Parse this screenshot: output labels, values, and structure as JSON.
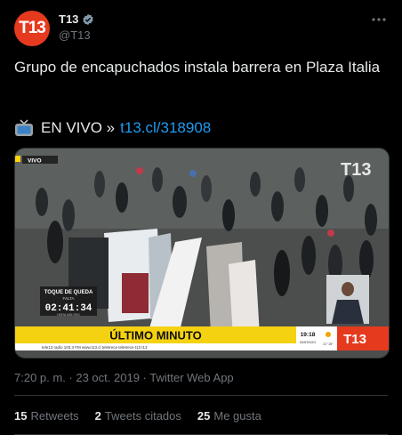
{
  "tweet": {
    "author": {
      "display_name": "T13",
      "handle": "@T13",
      "avatar_logo": "T13"
    },
    "text": "Grupo de encapuchados instala barrera en Plaza Italia",
    "live_label": "EN VIVO »",
    "live_link": "t13.cl/318908",
    "timestamp": "7:20 p. m. · 23 oct. 2019 · Twitter Web App",
    "stats": {
      "retweets_count": "15",
      "retweets_label": "Retweets",
      "quotes_count": "2",
      "quotes_label": "Tweets citados",
      "likes_count": "25",
      "likes_label": "Me gusta"
    }
  },
  "broadcast": {
    "live_tag": "VIVO",
    "channel_logo": "T13",
    "curfew_title": "TOQUE DE QUEDA",
    "curfew_sub": "FALTA",
    "curfew_time": "02:41:34",
    "curfew_units": "HORA  MIN  SEG",
    "banner": "ÚLTIMO MINUTO",
    "ticker": "tele13 radio 103.3 FM   www.t13.cl   teletrece   teletrece   t13   t13",
    "clock": "19:18",
    "city": "SANTIAGO",
    "temp": "21° 25°"
  },
  "colors": {
    "accent": "#1d9bf0",
    "brand": "#e63a1e",
    "banner_yellow": "#f5d211",
    "verified": "#829aab"
  }
}
